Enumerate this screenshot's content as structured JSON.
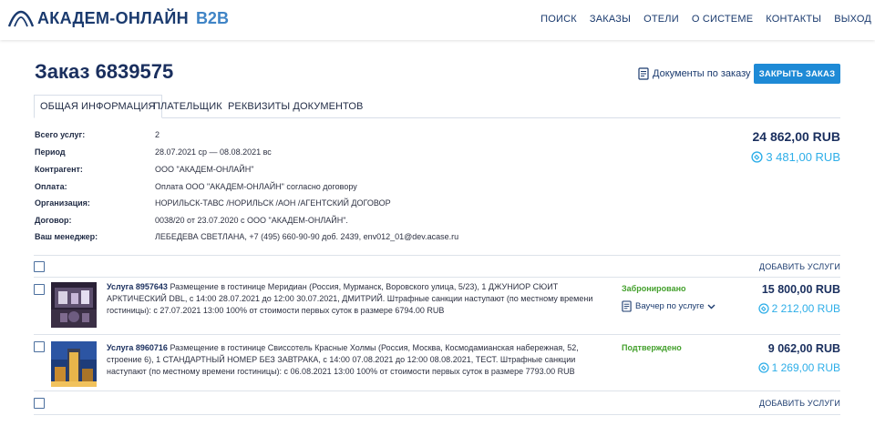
{
  "header": {
    "brand_name": "АКАДЕМ-ОНЛАЙН",
    "brand_suffix": "B2B",
    "nav": [
      "ПОИСК",
      "ЗАКАЗЫ",
      "ОТЕЛИ",
      "О СИСТЕМЕ",
      "КОНТАКТЫ",
      "ВЫХОД"
    ]
  },
  "order": {
    "title": "Заказ 6839575",
    "documents_label": "Документы по заказу",
    "close_button": "ЗАКРЫТЬ ЗАКАЗ"
  },
  "tabs": [
    "ОБЩАЯ ИНФОРМАЦИЯ",
    "ПЛАТЕЛЬЩИК",
    "РЕКВИЗИТЫ ДОКУМЕНТОВ"
  ],
  "info": [
    {
      "label": "Всего услуг:",
      "value": "2"
    },
    {
      "label": "Период",
      "value": "28.07.2021 ср — 08.08.2021 вс"
    },
    {
      "label": "Контрагент:",
      "value": "ООО \"АКАДЕМ-ОНЛАЙН\""
    },
    {
      "label": "Оплата:",
      "value": "Оплата ООО \"АКАДЕМ-ОНЛАЙН\" согласно договору"
    },
    {
      "label": "Организация:",
      "value": "НОРИЛЬСК-ТАВС /НОРИЛЬСК /АОН /АГЕНТСКИЙ ДОГОВОР"
    },
    {
      "label": "Договор:",
      "value": "0038/20 от 23.07.2020 с ООО \"АКАДЕМ-ОНЛАЙН\"."
    },
    {
      "label": "Ваш менеджер:",
      "value": "ЛЕБЕДЕВА СВЕТЛАНА, +7 (495) 660-90-90 доб. 2439, env012_01@dev.acase.ru"
    }
  ],
  "totals": {
    "amount": "24 862,00 RUB",
    "bonus": "3 481,00 RUB"
  },
  "add_services_label": "ДОБАВИТЬ УСЛУГИ",
  "services": [
    {
      "title": "Услуга 8957643",
      "description": "Размещение в гостинице Меридиан (Россия, Мурманск, Воровского улица, 5/23), 1 ДЖУНИОР СЮИТ АРКТИЧЕСКИЙ DBL, с 14:00 28.07.2021 до 12:00 30.07.2021, ДМИТРИЙ. Штрафные санкции наступают (по местному времени гостиницы): с 27.07.2021 13:00 100% от стоимости первых суток в размере 6794.00 RUB",
      "status": "Забронировано",
      "voucher_label": "Ваучер по услуге",
      "price": "15 800,00 RUB",
      "bonus": "2 212,00 RUB"
    },
    {
      "title": "Услуга 8960716",
      "description": "Размещение в гостинице Свиссотель Красные Холмы (Россия, Москва, Космодамианская набережная, 52, строение 6), 1 СТАНДАРТНЫЙ НОМЕР БЕЗ ЗАВТРАКА, с 14:00 07.08.2021 до 12:00 08.08.2021, ТЕСТ. Штрафные санкции наступают (по местному времени гостиницы): с 06.08.2021 13:00 100% от стоимости первых суток в размере 7793.00 RUB",
      "status": "Подтверждено",
      "price": "9 062,00 RUB",
      "bonus": "1 269,00 RUB"
    }
  ],
  "colors": {
    "brand": "#1a3a6e",
    "accent": "#1e8ad6",
    "bonus": "#2eaee8",
    "status_ok": "#43a02c"
  }
}
